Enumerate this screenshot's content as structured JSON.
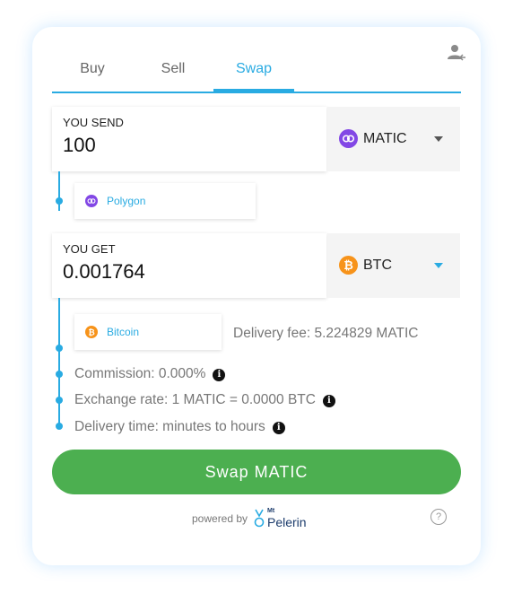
{
  "tabs": [
    {
      "label": "Buy",
      "active": false
    },
    {
      "label": "Sell",
      "active": false
    },
    {
      "label": "Swap",
      "active": true
    }
  ],
  "send": {
    "label": "YOU SEND",
    "amount": "100",
    "currency": "MATIC",
    "currency_icon": "polygon-icon",
    "network": "Polygon"
  },
  "get": {
    "label": "YOU GET",
    "amount": "0.001764",
    "currency": "BTC",
    "currency_icon": "bitcoin-icon",
    "network": "Bitcoin"
  },
  "delivery_fee": "Delivery fee: 5.224829 MATIC",
  "commission": "Commission: 0.000%",
  "exchange_rate": "Exchange rate: 1 MATIC = 0.0000 BTC",
  "delivery_time": "Delivery time: minutes to hours",
  "swap_button": "Swap MATIC",
  "powered_by": "powered by",
  "logo": {
    "prefix": "Mt",
    "name": "Pelerin"
  },
  "colors": {
    "accent": "#29abe2",
    "button": "#4caf50",
    "polygon": "#8247e5",
    "bitcoin": "#f7931a"
  }
}
